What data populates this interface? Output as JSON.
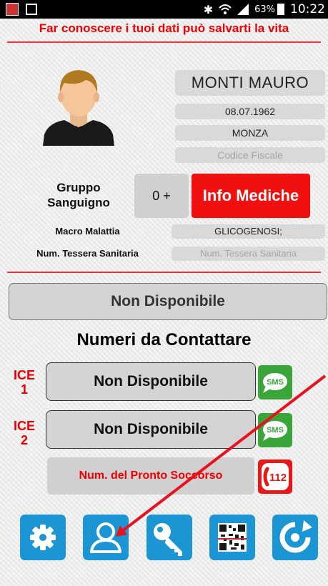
{
  "status_bar": {
    "battery": "63%",
    "time": "10:22"
  },
  "slogan": "Far conoscere i tuoi dati può salvarti la vita",
  "profile": {
    "name": "MONTI MAURO",
    "birth_date": "08.07.1962",
    "city": "MONZA",
    "fiscal_code_placeholder": "Codice Fiscale"
  },
  "blood_group": {
    "label_line1": "Gruppo",
    "label_line2": "Sanguigno",
    "value": "0 +"
  },
  "medical_info_button": "Info Mediche",
  "macro_disease": {
    "label": "Macro Malattia",
    "value": "GLICOGENOSI;"
  },
  "health_card": {
    "label": "Num. Tessera Sanitaria",
    "placeholder": "Num. Tessera Sanitaria"
  },
  "availability_status": "Non Disponibile",
  "contacts": {
    "title": "Numeri da Contattare",
    "ice1": {
      "label_line1": "ICE",
      "label_line2": "1",
      "value": "Non Disponibile",
      "sms_label": "SMS"
    },
    "ice2": {
      "label_line1": "ICE",
      "label_line2": "2",
      "value": "Non Disponibile",
      "sms_label": "SMS"
    },
    "emergency": {
      "label": "Num. del Pronto Soccorso",
      "number": "112"
    }
  },
  "bottom_icons": [
    "settings-icon",
    "user-profile-icon",
    "key-icon",
    "qr-code-icon",
    "refresh-icon"
  ],
  "colors": {
    "accent_red": "#f01010",
    "button_blue": "#1b95d3",
    "sms_green": "#3aa63a"
  }
}
